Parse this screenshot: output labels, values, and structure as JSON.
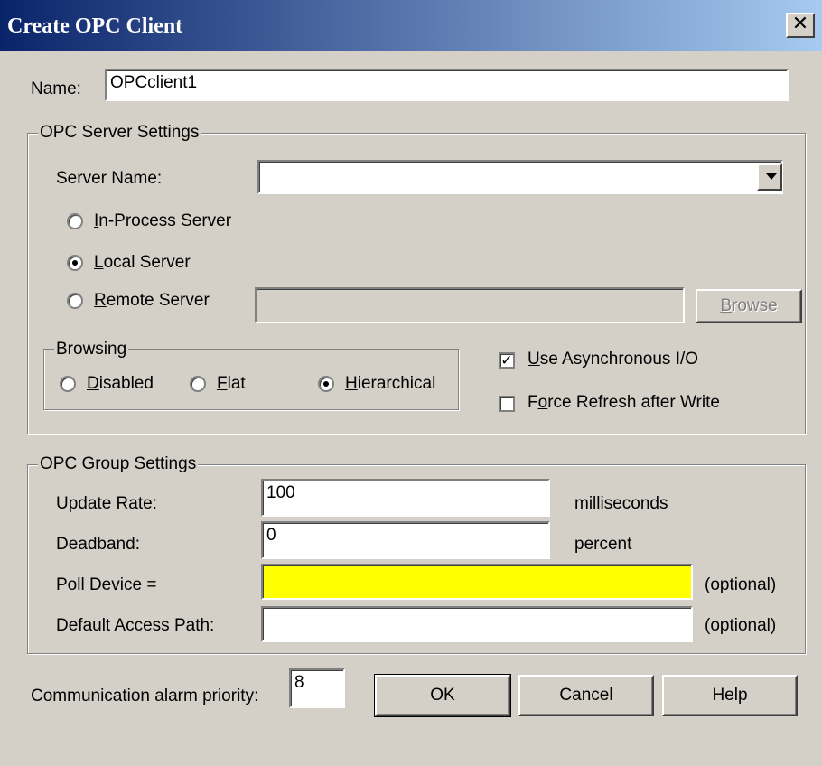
{
  "window": {
    "title": "Create OPC Client",
    "close_glyph": "✕"
  },
  "name": {
    "label": "Name:",
    "value": "OPCclient1"
  },
  "server_settings": {
    "legend": "OPC Server Settings",
    "server_name_label": "Server Name:",
    "server_name_value": "",
    "radios": {
      "in_process": {
        "accel": "I",
        "rest": "n-Process Server",
        "selected": false
      },
      "local": {
        "accel": "L",
        "rest": "ocal Server",
        "selected": true
      },
      "remote": {
        "accel": "R",
        "rest": "emote Server",
        "selected": false
      }
    },
    "remote_value": "",
    "browse_button": {
      "accel": "B",
      "rest": "rowse"
    },
    "browsing": {
      "legend": "Browsing",
      "disabled": {
        "accel": "D",
        "rest": "isabled",
        "selected": false
      },
      "flat": {
        "accel": "F",
        "rest": "lat",
        "selected": false
      },
      "hierarchical": {
        "accel": "H",
        "rest": "ierarchical",
        "selected": true
      }
    },
    "async_io": {
      "accel": "U",
      "rest": "se Asynchronous I/O",
      "checked": true
    },
    "force_refresh": {
      "accel": "o",
      "pre": "F",
      "rest": "rce Refresh after Write",
      "checked": false
    }
  },
  "group_settings": {
    "legend": "OPC Group Settings",
    "update_rate": {
      "label": "Update Rate:",
      "value": "100",
      "unit": "milliseconds"
    },
    "deadband": {
      "label": "Deadband:",
      "value": "0",
      "unit": "percent"
    },
    "poll_device": {
      "label": "Poll Device =",
      "value": "",
      "note": "(optional)"
    },
    "access_path": {
      "label": "Default Access Path:",
      "value": "",
      "note": "(optional)"
    }
  },
  "alarm_priority": {
    "label": "Communication alarm priority:",
    "value": "8"
  },
  "buttons": {
    "ok": "OK",
    "cancel": "Cancel",
    "help": "Help"
  },
  "colors": {
    "title_start": "#0a246a",
    "title_end": "#a6caf0",
    "dialog_bg": "#d4d0c8",
    "poll_device_bg": "#ffff00"
  }
}
